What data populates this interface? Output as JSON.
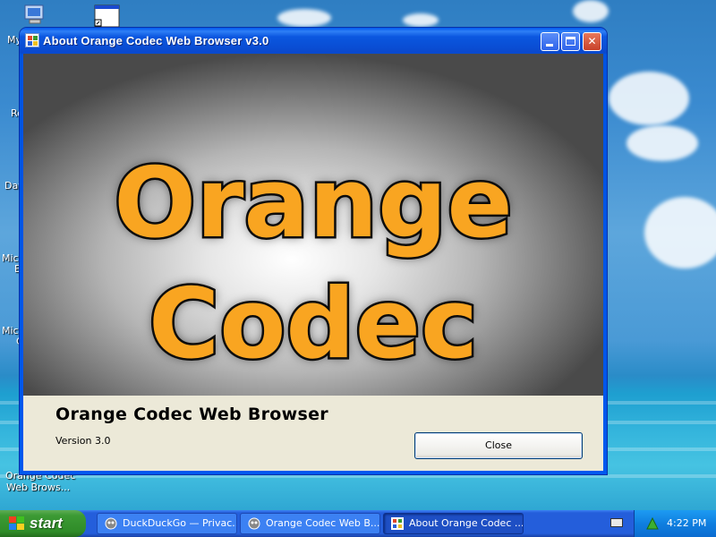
{
  "desktop": {
    "icons": [
      {
        "label": "My"
      },
      {
        "label": "Re"
      },
      {
        "label": "Dat"
      },
      {
        "label": "Micr"
      },
      {
        "label": "E"
      },
      {
        "label": "Micr"
      },
      {
        "label": "C"
      },
      {
        "label_line1": "Orange Codec",
        "label_line2": "Web Brows..."
      }
    ]
  },
  "window": {
    "title": "About Orange Codec Web Browser v3.0",
    "banner_line1": "Orange",
    "banner_line2": "Codec",
    "app_name": "Orange Codec Web Browser",
    "version": "Version 3.0",
    "close_label": "Close",
    "buttons": {
      "minimize": "_",
      "maximize": "□",
      "close": "✕"
    }
  },
  "taskbar": {
    "start_label": "start",
    "tasks": [
      {
        "label": "DuckDuckGo — Privac...",
        "icon": "browser-icon"
      },
      {
        "label": "Orange Codec Web B...",
        "icon": "browser-icon"
      },
      {
        "label": "About Orange Codec ...",
        "icon": "app-icon"
      }
    ],
    "clock": "4:22 PM"
  },
  "colors": {
    "accent": "#f9a521",
    "titlebar": "#0058ee",
    "start": "#3c9a34"
  }
}
